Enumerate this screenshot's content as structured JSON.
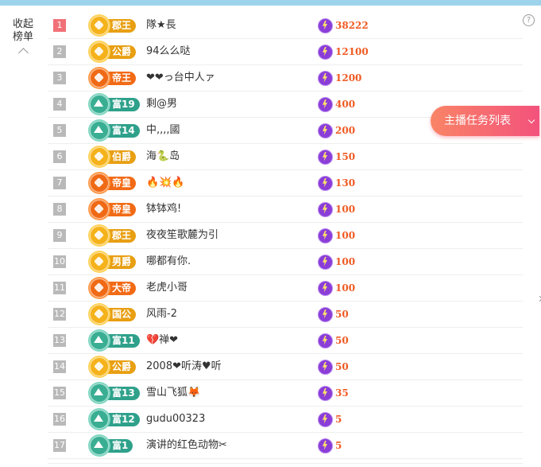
{
  "header": {
    "help_icon": "?",
    "collapse_label_1": "收起",
    "collapse_label_2": "榜单"
  },
  "task_button": {
    "label": "主播任务列表"
  },
  "colors": {
    "gold": "#e89f12",
    "orange": "#f26a15",
    "teal": "#2fa18b",
    "score": "#ef5a22",
    "rank1": "#f07177"
  },
  "rows": [
    {
      "rank": "1",
      "level": "郡王",
      "style": "gold",
      "name": "隊★長",
      "score": "38222"
    },
    {
      "rank": "2",
      "level": "公爵",
      "style": "gold",
      "name": "94么么哒",
      "score": "12100"
    },
    {
      "rank": "3",
      "level": "帝王",
      "style": "orange",
      "name": "❤❤っ台中人ァ",
      "score": "1200"
    },
    {
      "rank": "4",
      "level": "富19",
      "style": "teal",
      "name": "剩@男",
      "score": "400"
    },
    {
      "rank": "5",
      "level": "富14",
      "style": "teal",
      "name": "中,,,,國",
      "score": "200"
    },
    {
      "rank": "6",
      "level": "伯爵",
      "style": "gold",
      "name": "海🐍岛",
      "score": "150"
    },
    {
      "rank": "7",
      "level": "帝皇",
      "style": "orange",
      "name": "🔥💥🔥",
      "score": "130"
    },
    {
      "rank": "8",
      "level": "帝皇",
      "style": "orange",
      "name": "钵钵鸡!",
      "score": "100"
    },
    {
      "rank": "9",
      "level": "郡王",
      "style": "gold",
      "name": "夜夜笙歌麓为引",
      "score": "100"
    },
    {
      "rank": "10",
      "level": "男爵",
      "style": "gold",
      "name": "哪都有你.",
      "score": "100"
    },
    {
      "rank": "11",
      "level": "大帝",
      "style": "orange",
      "name": "老虎小哥",
      "score": "100"
    },
    {
      "rank": "12",
      "level": "国公",
      "style": "gold",
      "name": "风雨-2",
      "score": "50"
    },
    {
      "rank": "13",
      "level": "富11",
      "style": "teal",
      "name": "💔禅❤",
      "score": "50"
    },
    {
      "rank": "14",
      "level": "公爵",
      "style": "gold",
      "name": "2008❤听涛♥听",
      "score": "50"
    },
    {
      "rank": "15",
      "level": "富13",
      "style": "teal",
      "name": "雪山飞狐🦊",
      "score": "35"
    },
    {
      "rank": "16",
      "level": "富12",
      "style": "teal",
      "name": "gudu00323",
      "score": "5"
    },
    {
      "rank": "17",
      "level": "富1",
      "style": "teal",
      "name": "演讲的红色动物✂",
      "score": "5"
    }
  ]
}
